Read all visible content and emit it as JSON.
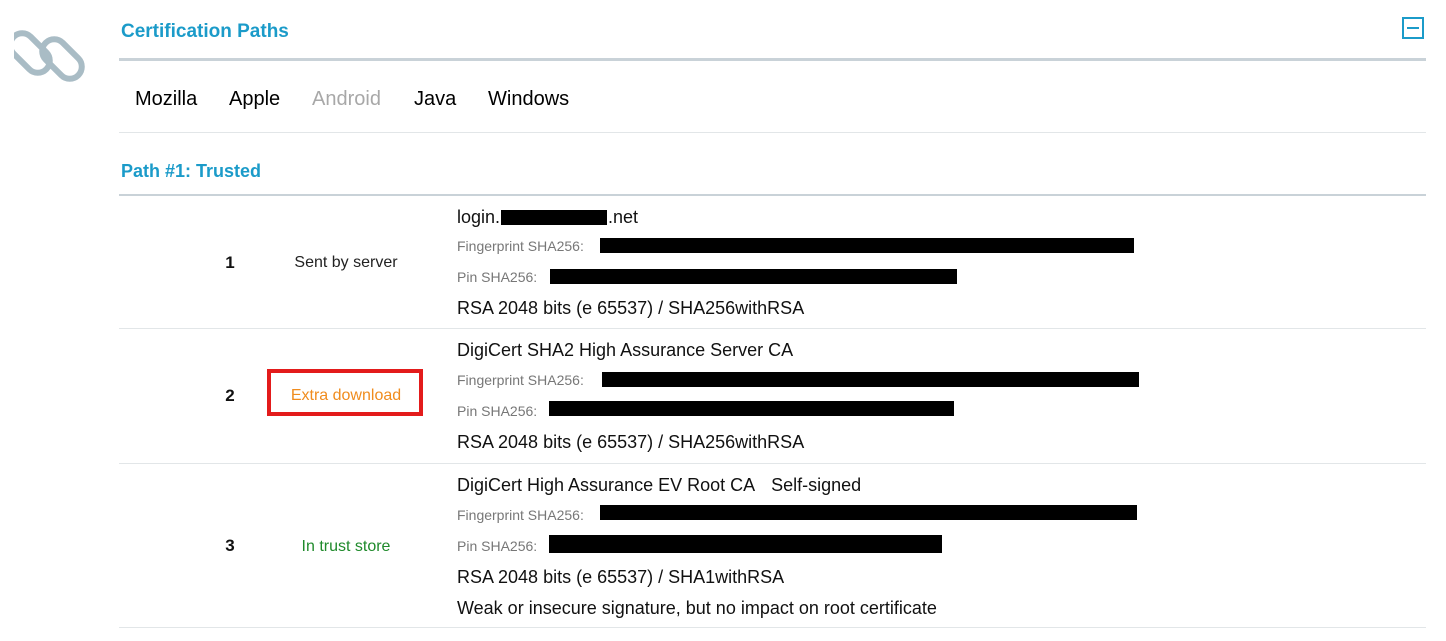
{
  "section": {
    "title": "Certification Paths",
    "tabs": [
      {
        "label": "Mozilla",
        "disabled": false
      },
      {
        "label": "Apple",
        "disabled": false
      },
      {
        "label": "Android",
        "disabled": true
      },
      {
        "label": "Java",
        "disabled": false
      },
      {
        "label": "Windows",
        "disabled": false
      }
    ],
    "path_title": "Path #1: Trusted"
  },
  "certs": [
    {
      "num": "1",
      "status": "Sent by server",
      "name_prefix": "login.",
      "name_suffix": ".net",
      "fingerprint_label": "Fingerprint SHA256:",
      "pin_label": "Pin SHA256:",
      "key_info": "RSA 2048 bits (e 65537) / SHA256withRSA"
    },
    {
      "num": "2",
      "status": "Extra download",
      "name": "DigiCert SHA2 High Assurance Server CA",
      "fingerprint_label": "Fingerprint SHA256:",
      "pin_label": "Pin SHA256:",
      "key_info": "RSA 2048 bits (e 65537) / SHA256withRSA"
    },
    {
      "num": "3",
      "status": "In trust store",
      "name": "DigiCert High Assurance EV Root CA",
      "self_signed": "Self-signed",
      "fingerprint_label": "Fingerprint SHA256:",
      "pin_label": "Pin SHA256:",
      "key_info": "RSA 2048 bits (e 65537) / SHA1withRSA",
      "note": "Weak or insecure signature, but no impact on root certificate"
    }
  ],
  "colors": {
    "accent": "#1b9bc9",
    "extra_download": "#f08c1e",
    "trust_store": "#1f8a2b",
    "highlight_box": "#e31b1b"
  }
}
